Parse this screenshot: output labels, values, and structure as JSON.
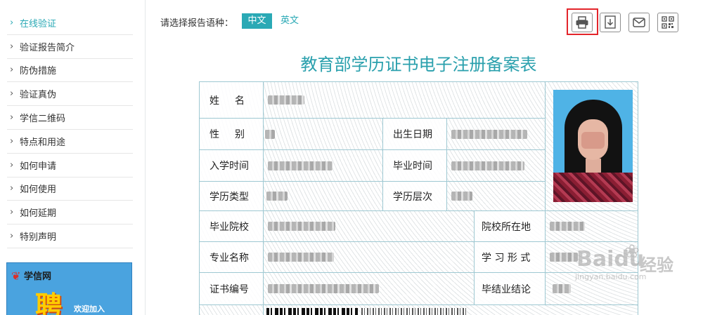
{
  "sidebar": {
    "items": [
      {
        "label": "在线验证",
        "active": true
      },
      {
        "label": "验证报告简介"
      },
      {
        "label": "防伪措施"
      },
      {
        "label": "验证真伪"
      },
      {
        "label": "学信二维码"
      },
      {
        "label": "特点和用途"
      },
      {
        "label": "如何申请"
      },
      {
        "label": "如何使用"
      },
      {
        "label": "如何延期"
      },
      {
        "label": "特别声明"
      }
    ],
    "ad": {
      "brand": "学信网",
      "headline": "聘",
      "tagline": "欢迎加入"
    }
  },
  "toolbar": {
    "language_label": "请选择报告语种：",
    "lang_chinese": "中文",
    "lang_english": "英文",
    "tools": [
      "print-icon",
      "download-icon",
      "email-icon",
      "qrcode-icon"
    ],
    "highlighted_tool": "print-icon",
    "accent_color": "#2aa9b5",
    "highlight_color": "#e3252b"
  },
  "document": {
    "title": "教育部学历证书电子注册备案表",
    "fields": {
      "name": "姓　名",
      "gender": "性　别",
      "birth_date": "出生日期",
      "enroll_date": "入学时间",
      "graduate_date": "毕业时间",
      "edu_type": "学历类型",
      "edu_level": "学历层次",
      "school": "毕业院校",
      "school_location": "院校所在地",
      "major": "专业名称",
      "study_form": "学 习 形 式",
      "cert_no": "证书编号",
      "conclusion": "毕结业结论"
    }
  },
  "watermark": {
    "brand": "Baidu",
    "cn": "经验",
    "sub": "jingyan.baidu.com"
  }
}
